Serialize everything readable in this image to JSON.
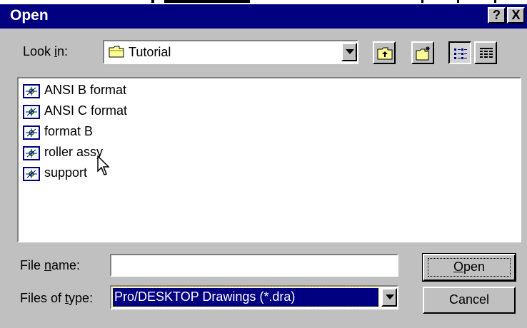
{
  "dialog": {
    "title": "Open",
    "help_label": "?",
    "close_label": "X"
  },
  "lookin": {
    "label_pre": "Look ",
    "label_ul": "i",
    "label_post": "n:",
    "value": "Tutorial"
  },
  "toolbar": {
    "up_one_level_icon": "folder-up-icon",
    "new_folder_icon": "new-folder-icon",
    "list_view_icon": "list-view-icon",
    "details_view_icon": "details-view-icon"
  },
  "files": [
    {
      "name": "ANSI B format"
    },
    {
      "name": "ANSI C format"
    },
    {
      "name": "format B"
    },
    {
      "name": "roller assy"
    },
    {
      "name": "support"
    }
  ],
  "filename": {
    "label_pre": "File ",
    "label_ul": "n",
    "label_post": "ame:",
    "value": ""
  },
  "filetype": {
    "label_pre": "Files of ",
    "label_ul": "t",
    "label_post": "ype:",
    "value": "Pro/DESKTOP Drawings (*.dra)"
  },
  "buttons": {
    "open_ul": "O",
    "open_rest": "pen",
    "cancel": "Cancel"
  },
  "colors": {
    "titlebar": "#000080",
    "face": "#c0c0c0",
    "selection": "#000080"
  }
}
